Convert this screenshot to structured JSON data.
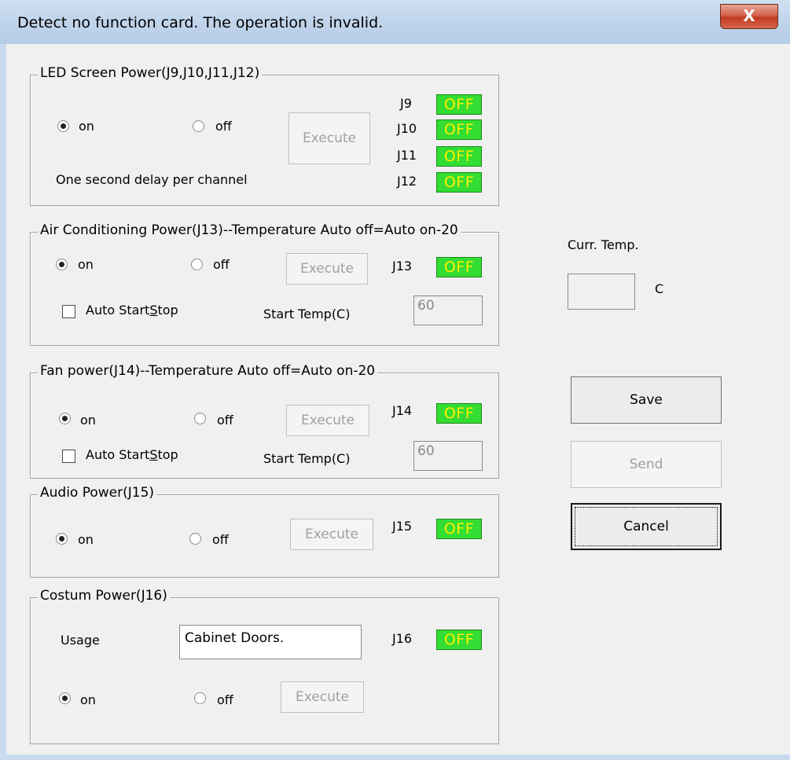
{
  "window": {
    "title": "Detect no function card. The operation is invalid.",
    "close_glyph": "X"
  },
  "led": {
    "title": "LED Screen Power(J9,J10,J11,J12)",
    "on_label": "on",
    "off_label": "off",
    "execute": "Execute",
    "note": "One second delay per channel",
    "channels": [
      {
        "label": "J9",
        "status": "OFF"
      },
      {
        "label": "J10",
        "status": "OFF"
      },
      {
        "label": "J11",
        "status": "OFF"
      },
      {
        "label": "J12",
        "status": "OFF"
      }
    ]
  },
  "air": {
    "title": "Air Conditioning Power(J13)--Temperature Auto off=Auto on-20",
    "on_label": "on",
    "off_label": "off",
    "execute": "Execute",
    "channel": "J13",
    "status": "OFF",
    "auto_prefix": "Auto Start",
    "auto_underlined": "S",
    "auto_suffix": "top",
    "start_temp_label": "Start Temp(C)",
    "start_temp_value": "60"
  },
  "fan": {
    "title": "Fan power(J14)--Temperature Auto off=Auto on-20",
    "on_label": "on",
    "off_label": "off",
    "execute": "Execute",
    "channel": "J14",
    "status": "OFF",
    "auto_prefix": "Auto Start",
    "auto_underlined": "S",
    "auto_suffix": "top",
    "start_temp_label": "Start Temp(C)",
    "start_temp_value": "60"
  },
  "audio": {
    "title": "Audio Power(J15)",
    "on_label": "on",
    "off_label": "off",
    "execute": "Execute",
    "channel": "J15",
    "status": "OFF"
  },
  "custom": {
    "title": "Costum Power(J16)",
    "usage_label": "Usage",
    "usage_value": "Cabinet Doors.",
    "on_label": "on",
    "off_label": "off",
    "execute": "Execute",
    "channel": "J16",
    "status": "OFF"
  },
  "side": {
    "curr_temp_label": "Curr. Temp.",
    "curr_temp_value": "",
    "unit": "C",
    "save": "Save",
    "send": "Send",
    "cancel": "Cancel"
  }
}
